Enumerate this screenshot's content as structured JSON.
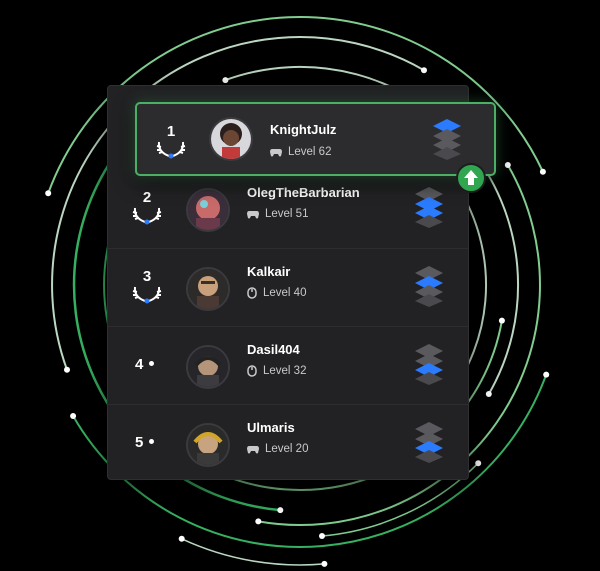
{
  "leaderboard": {
    "players": [
      {
        "rank": "1",
        "name": "KnightJulz",
        "level_text": "Level 62",
        "device_icon": "gamepad-icon",
        "highlighted": true
      },
      {
        "rank": "2",
        "name": "OlegTheBarbarian",
        "level_text": "Level 51",
        "device_icon": "gamepad-icon",
        "highlighted": false
      },
      {
        "rank": "3",
        "name": "Kalkair",
        "level_text": "Level 40",
        "device_icon": "mouse-icon",
        "highlighted": false
      },
      {
        "rank": "4",
        "name": "Dasil404",
        "level_text": "Level 32",
        "device_icon": "mouse-icon",
        "highlighted": false
      },
      {
        "rank": "5",
        "name": "Ulmaris",
        "level_text": "Level 20",
        "device_icon": "gamepad-icon",
        "highlighted": false
      }
    ]
  },
  "colors": {
    "accent_green": "#4caf66",
    "tier_blue": "#2b7bff",
    "tier_gray": "#5a5a5e",
    "background": "#000000",
    "panel": "#222224"
  }
}
